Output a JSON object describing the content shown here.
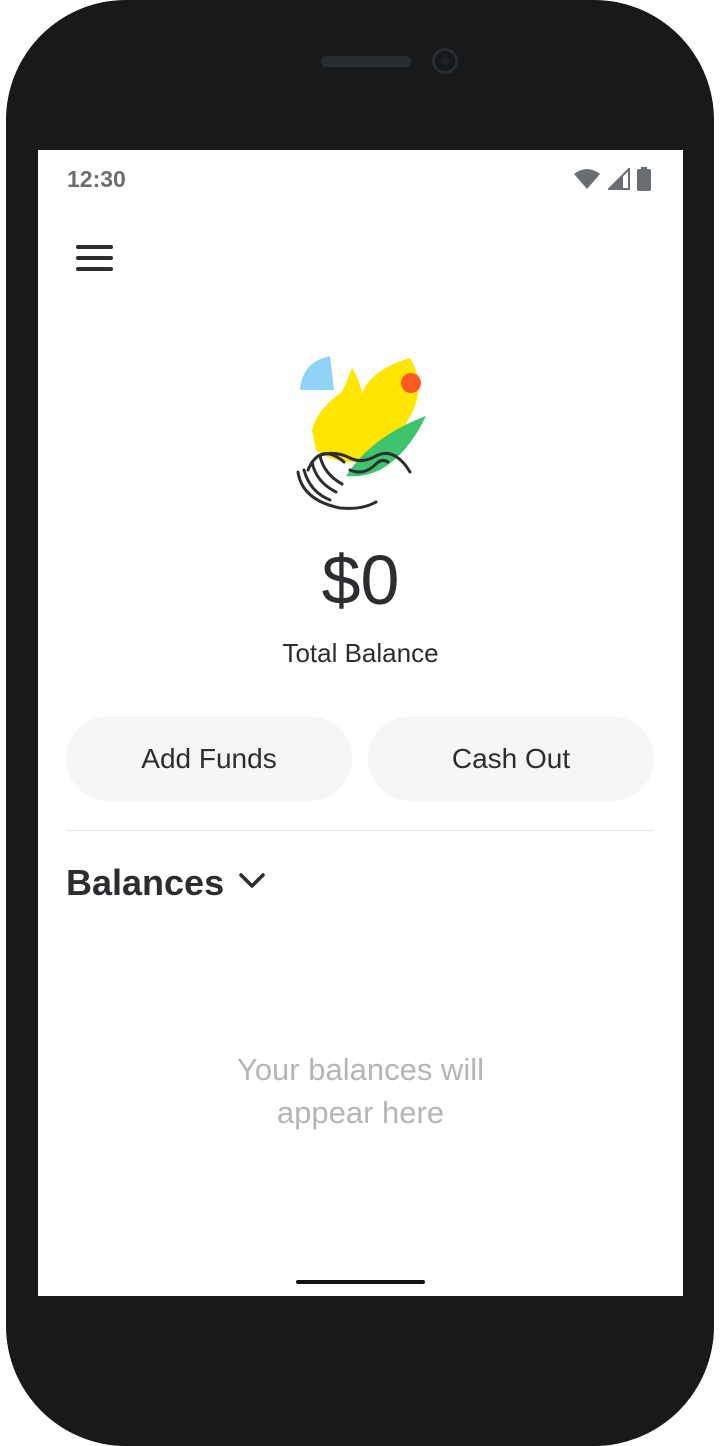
{
  "status_bar": {
    "time": "12:30",
    "icons": [
      "wifi-icon",
      "signal-icon",
      "battery-icon"
    ]
  },
  "header": {
    "menu_icon": "hamburger-menu-icon"
  },
  "hero": {
    "illustration": "bird-hand-illustration",
    "amount": "$0",
    "label": "Total Balance"
  },
  "actions": {
    "add_funds_label": "Add Funds",
    "cash_out_label": "Cash Out"
  },
  "balances": {
    "title": "Balances",
    "chevron_icon": "chevron-down-icon",
    "empty_line1": "Your balances will",
    "empty_line2": "appear here"
  },
  "colors": {
    "text_primary": "#2b2d30",
    "text_muted": "#b3b5b8",
    "button_bg": "#f6f6f6",
    "bird_yellow": "#ffe500",
    "bird_blue": "#8fd3f7",
    "bird_green": "#3ec46d",
    "bird_orange": "#ff5a1f"
  }
}
